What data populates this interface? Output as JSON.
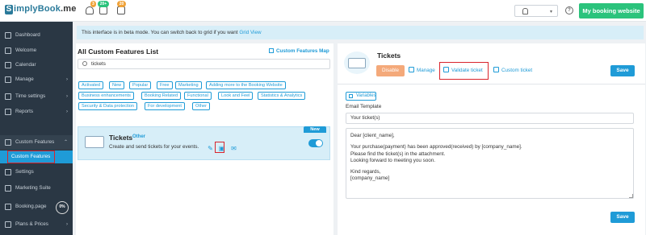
{
  "header": {
    "logo_prefix": "S",
    "logo_main": "implyBook",
    "logo_suffix": ".me",
    "badges": [
      "3",
      "20+",
      "20"
    ],
    "my_booking_label": "My booking website",
    "help_glyph": "?",
    "caret_glyph": "▾"
  },
  "sidebar": {
    "items": [
      {
        "label": "Dashboard",
        "icon": "dashboard-icon"
      },
      {
        "label": "Welcome",
        "icon": "welcome-icon"
      },
      {
        "label": "Calendar",
        "icon": "calendar-icon"
      },
      {
        "label": "Manage",
        "icon": "manage-icon",
        "arrow": "›"
      },
      {
        "label": "Time settings",
        "icon": "clock-icon",
        "arrow": "›"
      },
      {
        "label": "Reports",
        "icon": "reports-icon",
        "arrow": "›"
      },
      {
        "label": "Custom Features",
        "icon": "puzzle-icon",
        "arrow": "⌃"
      },
      {
        "label": "Custom Features",
        "icon": "",
        "active": true
      },
      {
        "label": "Settings",
        "icon": "gear-icon"
      },
      {
        "label": "Marketing Suite",
        "icon": "marketing-icon"
      },
      {
        "label": "Booking.page",
        "icon": "globe-icon"
      },
      {
        "label": "Plans & Prices",
        "icon": "plans-icon",
        "arrow": "›"
      }
    ],
    "progress_label": "0%"
  },
  "beta": {
    "text": "This interface is in beta mode. You can switch back to grid if you want ",
    "link": "Grid View"
  },
  "features_list": {
    "title": "All Custom Features List",
    "map_link": "Custom Features Map",
    "search_value": "tickets",
    "tags": [
      "Activated",
      "New",
      "Popular",
      "Free",
      "Marketing",
      "Adding more to the Booking Website",
      "Business enhancements",
      "Booking Related",
      "Functional",
      "Look and Feel",
      "Statistics & Analytics",
      "Security & Data protection",
      "For development",
      "Other"
    ],
    "card": {
      "name": "Tickets",
      "category": "Other",
      "description": "Create and send tickets for your events.",
      "new_badge": "New",
      "edit_glyph": "✎",
      "validate_glyph": "▣",
      "custom_glyph": "✉"
    }
  },
  "detail": {
    "title": "Tickets",
    "disable_label": "Disable",
    "tabs": [
      "Manage",
      "Validate ticket",
      "Custom ticket"
    ],
    "save_label": "Save",
    "variables_label": "Variables",
    "email_template_label": "Email Template",
    "subject_value": "Your ticket(s)",
    "body_lines": [
      "Dear [client_name],",
      "",
      "Your purchase(payment) has been approved(received) by [company_name].",
      "Please find the ticket(s) in the attachment.",
      "Looking forward to meeting you soon.",
      "",
      "Kind regards,",
      "[company_name]"
    ]
  },
  "colors": {
    "accent": "#1f9bd7",
    "green": "#2bc37c",
    "sidebar_bg": "#2a3744",
    "disable": "#f4a97a",
    "highlight_red": "#d9242c"
  }
}
